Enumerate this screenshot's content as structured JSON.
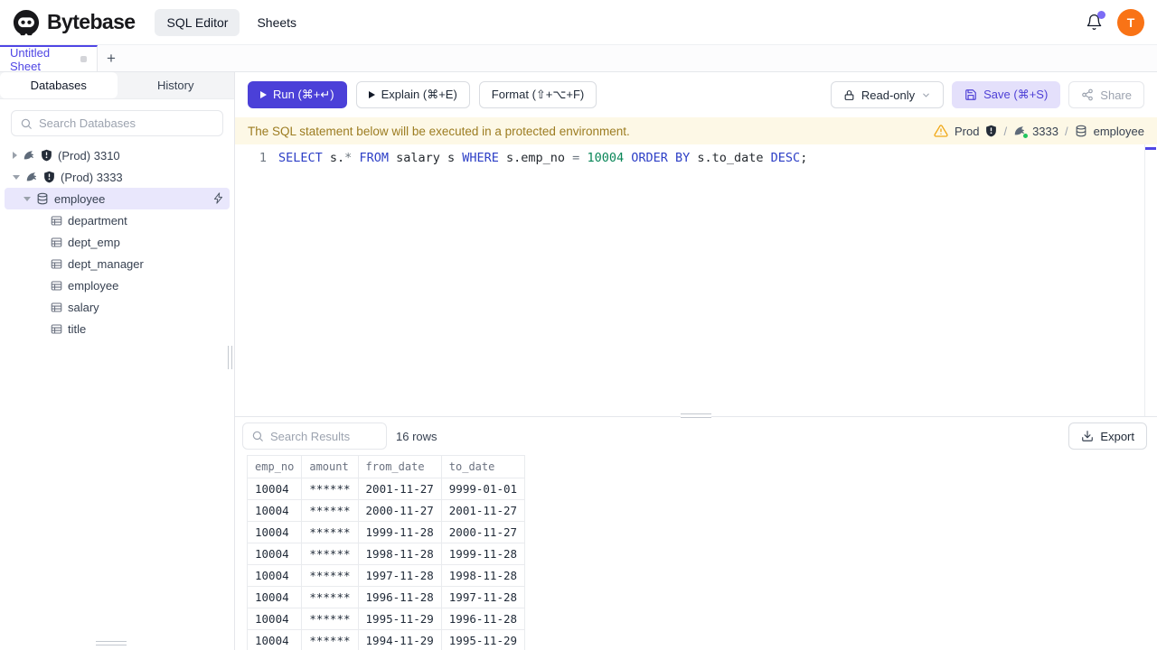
{
  "colors": {
    "accent": "#4f46e5",
    "run_button": "#4b40d8",
    "save_button_bg": "#e4e0fb",
    "warning_bg": "#fdf8e6",
    "warning_text": "#9c7c21",
    "warning_icon": "#f0a818",
    "avatar_bg": "#f97316",
    "notification_dot": "#7c6cf5",
    "sql_keyword": "#2d3fc6",
    "sql_number": "#098658",
    "success_dot": "#22c55e",
    "selected_row_bg": "#e9e7fc"
  },
  "header": {
    "brand": "Bytebase",
    "nav": [
      {
        "label": "SQL Editor",
        "active": true
      },
      {
        "label": "Sheets",
        "active": false
      }
    ],
    "avatar_initial": "T"
  },
  "tabbar": {
    "active_tab": "Untitled Sheet",
    "new_tab_label": "+"
  },
  "sidebar": {
    "tabs": [
      {
        "label": "Databases",
        "active": true
      },
      {
        "label": "History",
        "active": false
      }
    ],
    "search_placeholder": "Search Databases",
    "instances": [
      {
        "label": "(Prod) 3310",
        "expanded": false
      },
      {
        "label": "(Prod) 3333",
        "expanded": true
      }
    ],
    "database": "employee",
    "tables": [
      "department",
      "dept_emp",
      "dept_manager",
      "employee",
      "salary",
      "title"
    ]
  },
  "toolbar": {
    "run_label": "Run (⌘+↵)",
    "explain_label": "Explain (⌘+E)",
    "format_label": "Format (⇧+⌥+F)",
    "readonly_label": "Read-only",
    "save_label": "Save (⌘+S)",
    "share_label": "Share"
  },
  "banner": {
    "message": "The SQL statement below will be executed in a protected environment.",
    "environment": "Prod",
    "separator": "/",
    "instance": "3333",
    "database": "employee"
  },
  "editor": {
    "line_number": "1",
    "sql_text": "SELECT s.* FROM salary s WHERE s.emp_no = 10004 ORDER BY s.to_date DESC;",
    "tokens": [
      {
        "t": "SELECT",
        "c": "kw"
      },
      {
        "t": " s.",
        "c": "id"
      },
      {
        "t": "*",
        "c": "op"
      },
      {
        "t": " ",
        "c": "id"
      },
      {
        "t": "FROM",
        "c": "kw"
      },
      {
        "t": " salary s ",
        "c": "id"
      },
      {
        "t": "WHERE",
        "c": "kw"
      },
      {
        "t": " s.emp_no ",
        "c": "id"
      },
      {
        "t": "=",
        "c": "op"
      },
      {
        "t": " ",
        "c": "id"
      },
      {
        "t": "10004",
        "c": "num"
      },
      {
        "t": " ",
        "c": "id"
      },
      {
        "t": "ORDER BY",
        "c": "kw"
      },
      {
        "t": " s.to_date ",
        "c": "id"
      },
      {
        "t": "DESC",
        "c": "kw"
      },
      {
        "t": ";",
        "c": "id"
      }
    ]
  },
  "results": {
    "search_placeholder": "Search Results",
    "row_count": "16 rows",
    "export_label": "Export",
    "table": {
      "columns": [
        "emp_no",
        "amount",
        "from_date",
        "to_date"
      ],
      "rows": [
        [
          "10004",
          "******",
          "2001-11-27",
          "9999-01-01"
        ],
        [
          "10004",
          "******",
          "2000-11-27",
          "2001-11-27"
        ],
        [
          "10004",
          "******",
          "1999-11-28",
          "2000-11-27"
        ],
        [
          "10004",
          "******",
          "1998-11-28",
          "1999-11-28"
        ],
        [
          "10004",
          "******",
          "1997-11-28",
          "1998-11-28"
        ],
        [
          "10004",
          "******",
          "1996-11-28",
          "1997-11-28"
        ],
        [
          "10004",
          "******",
          "1995-11-29",
          "1996-11-28"
        ],
        [
          "10004",
          "******",
          "1994-11-29",
          "1995-11-29"
        ]
      ]
    }
  }
}
